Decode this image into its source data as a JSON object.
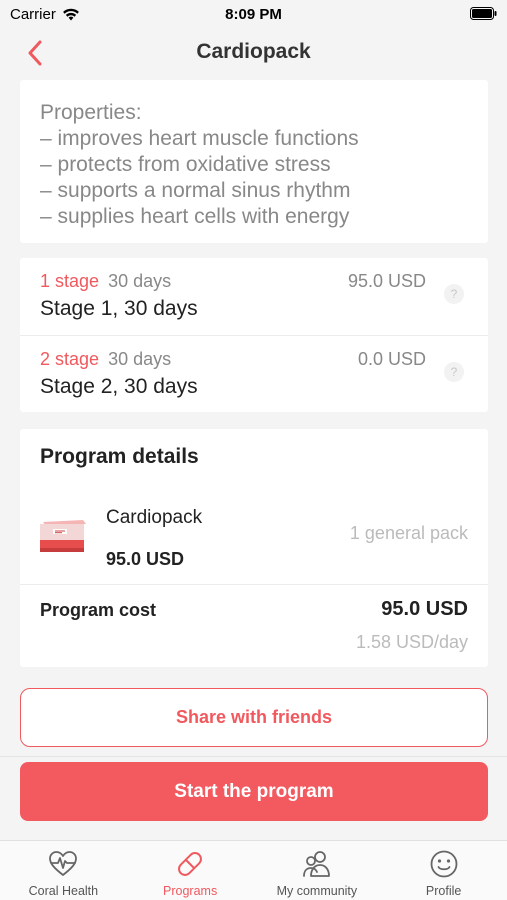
{
  "status_bar": {
    "carrier": "Carrier",
    "time": "8:09 PM"
  },
  "header": {
    "title": "Cardiopack"
  },
  "properties": {
    "lines": [
      "Properties:",
      "– improves heart muscle functions",
      "– protects from oxidative stress",
      "– supports a normal sinus rhythm",
      "– supplies heart cells with energy"
    ]
  },
  "stages": [
    {
      "label": "1 stage",
      "duration": "30 days",
      "price": "95.0 USD",
      "name": "Stage 1, 30 days",
      "help": "?"
    },
    {
      "label": "2 stage",
      "duration": "30 days",
      "price": "0.0 USD",
      "name": "Stage 2, 30 days",
      "help": "?"
    }
  ],
  "program_details": {
    "title": "Program details",
    "pack_name": "Cardiopack",
    "pack_price": "95.0 USD",
    "pack_quantity": "1 general pack",
    "cost_label": "Program cost",
    "cost_value": "95.0 USD",
    "cost_per_day": "1.58 USD/day"
  },
  "actions": {
    "share_label": "Share with friends",
    "start_label": "Start the program"
  },
  "tabs": [
    {
      "label": "Coral Health",
      "icon": "heart-pulse-icon",
      "active": false
    },
    {
      "label": "Programs",
      "icon": "pill-icon",
      "active": true
    },
    {
      "label": "My community",
      "icon": "community-icon",
      "active": false
    },
    {
      "label": "Profile",
      "icon": "smiley-icon",
      "active": false
    }
  ],
  "colors": {
    "accent": "#f0595e",
    "background": "#f4f4f4",
    "card": "#ffffff"
  }
}
